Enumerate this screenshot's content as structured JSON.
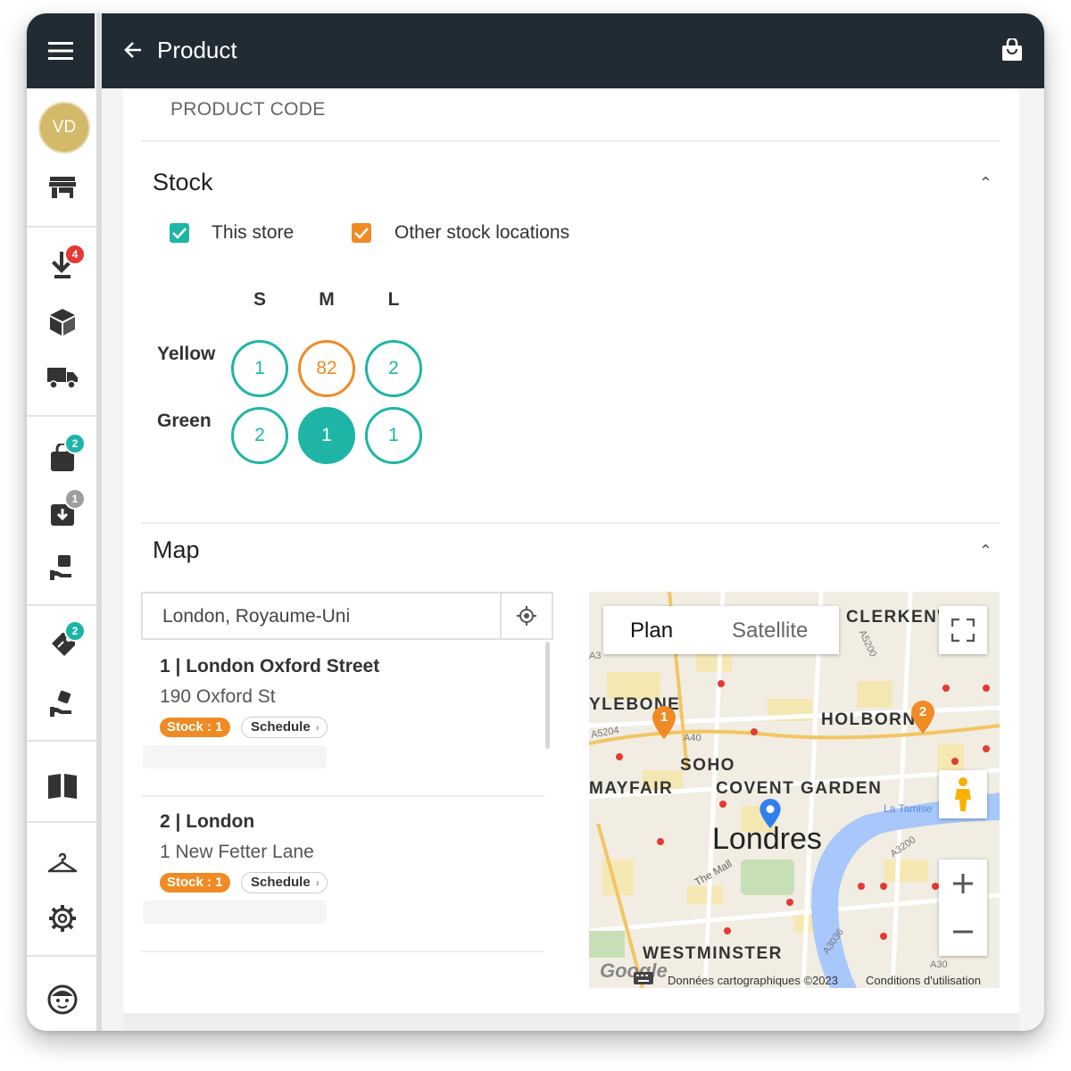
{
  "header": {
    "title": "Product"
  },
  "sidebar": {
    "avatar_initials": "VD",
    "badges": {
      "returns": "4",
      "orders": "2",
      "deliveries": "1",
      "promotions": "2"
    }
  },
  "product": {
    "code_label": "PRODUCT CODE"
  },
  "stock": {
    "title": "Stock",
    "filters": [
      {
        "label": "This store",
        "checked": true,
        "color": "#1fb5a6"
      },
      {
        "label": "Other stock locations",
        "checked": true,
        "color": "#f08a24"
      }
    ],
    "sizes": [
      "S",
      "M",
      "L"
    ],
    "rows": [
      {
        "color": "Yellow",
        "cells": [
          "1",
          "82",
          "2"
        ]
      },
      {
        "color": "Green",
        "cells": [
          "2",
          "1",
          "1"
        ]
      }
    ]
  },
  "map_section": {
    "title": "Map",
    "search_value": "London, Royaume-Uni",
    "stores": [
      {
        "title": "1 | London Oxford Street",
        "address": "190 Oxford St",
        "stock": "Stock : 1",
        "schedule": "Schedule"
      },
      {
        "title": "2 | London",
        "address": "1 New Fetter Lane",
        "stock": "Stock : 1",
        "schedule": "Schedule"
      }
    ],
    "map": {
      "type_plan": "Plan",
      "type_satellite": "Satellite",
      "city": "Londres",
      "places": [
        "CLERKENW",
        "YLEBONE",
        "HOLBORN",
        "SOHO",
        "MAYFAIR",
        "COVENT GARDEN",
        "WESTMINSTER"
      ],
      "roads": [
        "A5200",
        "A5204",
        "A40",
        "A3200",
        "A3036",
        "The Mall",
        "La Tamise",
        "A30",
        "A3"
      ],
      "markers": [
        "1",
        "2"
      ],
      "attribution": "Données cartographiques ©2023",
      "terms": "Conditions d'utilisation",
      "logo": "Google"
    }
  },
  "colors": {
    "topbar": "#212b33",
    "teal": "#1fb5a6",
    "orange": "#f08a24",
    "badge_red": "#e53935",
    "badge_teal": "#1fb5a6",
    "badge_grey": "#9e9e9e"
  }
}
